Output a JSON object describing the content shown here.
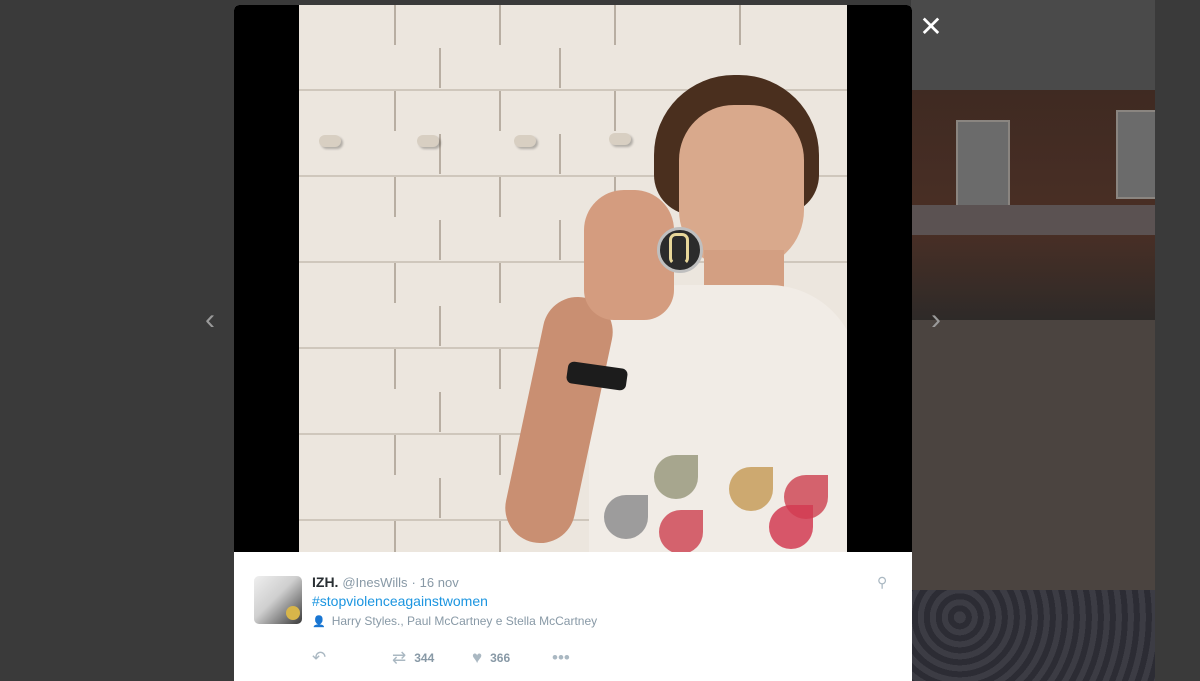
{
  "viewer": {
    "close_label": "✕",
    "prev_label": "‹",
    "next_label": "›"
  },
  "tweet": {
    "display_name": "IZH.",
    "handle": "@InesWills",
    "separator": "·",
    "date": "16 nov",
    "hashtag": "#stopviolenceagainstwomen",
    "tagged_people": "Harry Styles., Paul McCartney e Stella McCartney",
    "actions": {
      "reply_icon": "reply-icon",
      "retweet_count": "344",
      "like_count": "366",
      "more_icon": "more-icon"
    }
  },
  "colors": {
    "overlay_bg": "#3a3a3a",
    "link": "#1b95e0",
    "meta_text": "#8899a6",
    "primary_text": "#292f33"
  }
}
